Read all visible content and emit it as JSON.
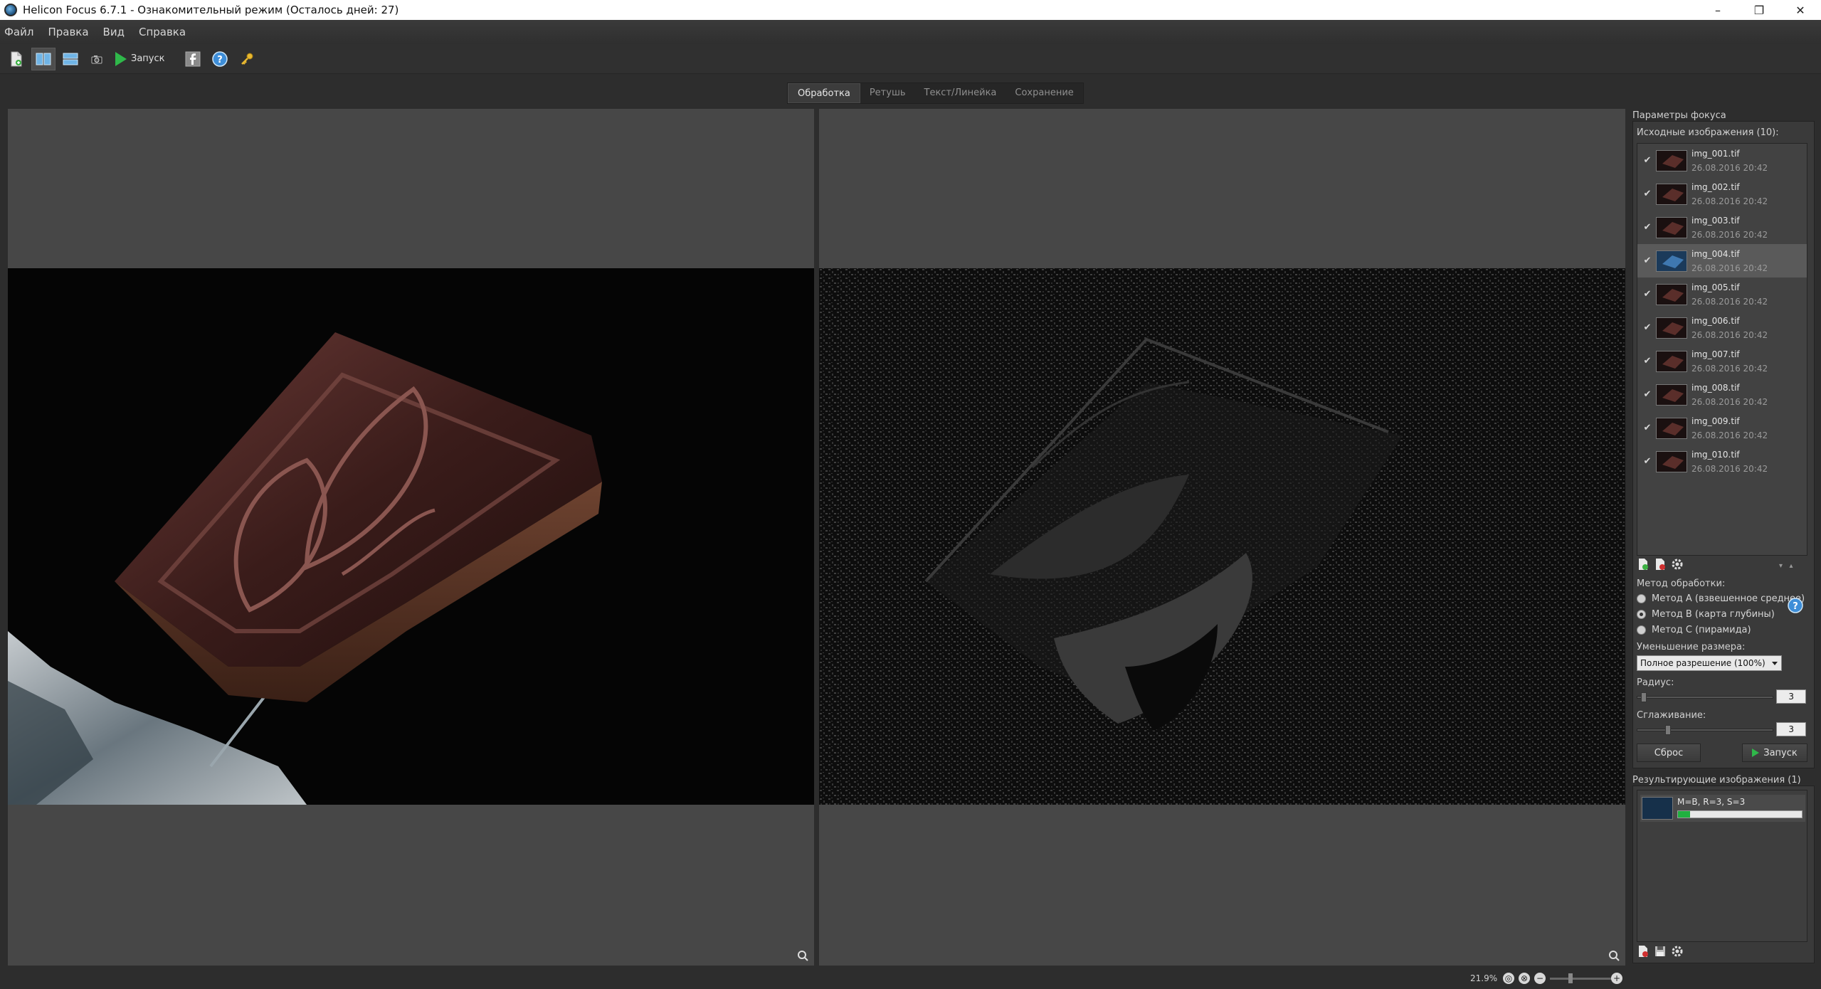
{
  "window": {
    "title": "Helicon Focus 6.7.1 - Ознакомительный режим (Осталось дней: 27)",
    "minimize": "–",
    "maximize": "❐",
    "close": "✕"
  },
  "menu": [
    "Файл",
    "Правка",
    "Вид",
    "Справка"
  ],
  "toolbar": {
    "run_label": "Запуск"
  },
  "tabs": [
    {
      "label": "Обработка",
      "active": true
    },
    {
      "label": "Ретушь",
      "active": false
    },
    {
      "label": "Текст/Линейка",
      "active": false
    },
    {
      "label": "Сохранение",
      "active": false
    }
  ],
  "panel": {
    "title": "Параметры фокуса",
    "source_label": "Исходные изображения (10):",
    "files": [
      {
        "name": "img_001.tif",
        "date": "26.08.2016 20:42",
        "checked": true,
        "selected": false
      },
      {
        "name": "img_002.tif",
        "date": "26.08.2016 20:42",
        "checked": true,
        "selected": false
      },
      {
        "name": "img_003.tif",
        "date": "26.08.2016 20:42",
        "checked": true,
        "selected": false
      },
      {
        "name": "img_004.tif",
        "date": "26.08.2016 20:42",
        "checked": true,
        "selected": true
      },
      {
        "name": "img_005.tif",
        "date": "26.08.2016 20:42",
        "checked": true,
        "selected": false
      },
      {
        "name": "img_006.tif",
        "date": "26.08.2016 20:42",
        "checked": true,
        "selected": false
      },
      {
        "name": "img_007.tif",
        "date": "26.08.2016 20:42",
        "checked": true,
        "selected": false
      },
      {
        "name": "img_008.tif",
        "date": "26.08.2016 20:42",
        "checked": true,
        "selected": false
      },
      {
        "name": "img_009.tif",
        "date": "26.08.2016 20:42",
        "checked": true,
        "selected": false
      },
      {
        "name": "img_010.tif",
        "date": "26.08.2016 20:42",
        "checked": true,
        "selected": false
      }
    ],
    "method_label": "Метод обработки:",
    "methods": [
      {
        "label": "Метод A (взвешенное среднее)",
        "selected": false
      },
      {
        "label": "Метод B (карта глубины)",
        "selected": true
      },
      {
        "label": "Метод C (пирамида)",
        "selected": false
      }
    ],
    "resize_label": "Уменьшение размера:",
    "resize_value": "Полное разрешение (100%)",
    "radius_label": "Радиус:",
    "radius_value": "3",
    "smoothing_label": "Сглаживание:",
    "smoothing_value": "3",
    "reset_label": "Сброс",
    "run_label": "Запуск",
    "results_label": "Результирующие изображения (1)",
    "result_item": "M=B, R=3, S=3",
    "result_progress": 0.1
  },
  "status": {
    "zoom": "21.9%"
  },
  "colors": {
    "accent_green": "#2fb84a",
    "progress_green": "#20b040"
  }
}
